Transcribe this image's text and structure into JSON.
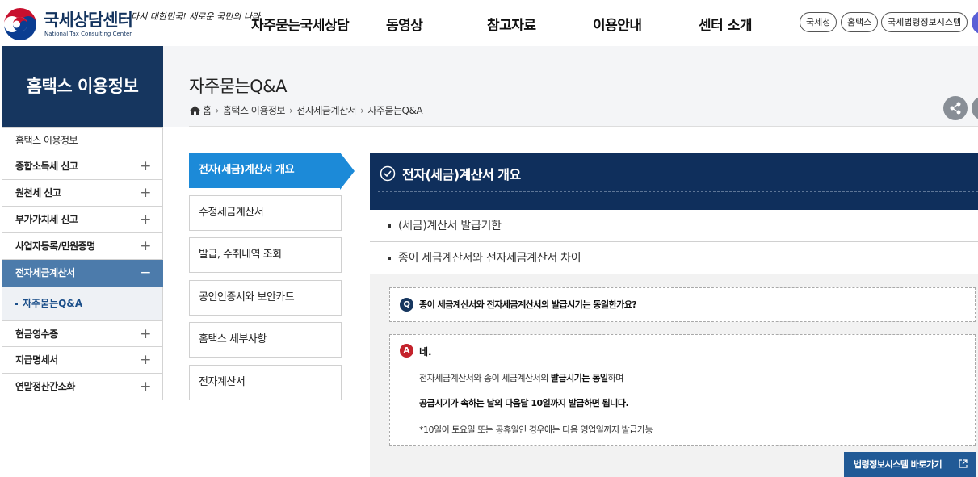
{
  "header": {
    "logo_title": "국세상담센터",
    "logo_subtitle": "National Tax Consulting Center",
    "logo_slogan": "다시 대한민국! 새로운 국민의 나라",
    "gnb": [
      "자주묻는국세상담",
      "동영상",
      "참고자료",
      "이용안내",
      "센터 소개"
    ],
    "util_links": [
      "국세청",
      "홈택스",
      "국세법령정보시스템"
    ]
  },
  "lnb": {
    "title": "홈택스 이용정보",
    "items": [
      {
        "label": "홈택스 이용정보",
        "toggle": ""
      },
      {
        "label": "종합소득세 신고",
        "toggle": "+"
      },
      {
        "label": "원천세 신고",
        "toggle": "+"
      },
      {
        "label": "부가가치세 신고",
        "toggle": "+"
      },
      {
        "label": "사업자등록/민원증명",
        "toggle": "+"
      },
      {
        "label": "전자세금계산서",
        "toggle": "−"
      },
      {
        "label": "현금영수증",
        "toggle": "+"
      },
      {
        "label": "지급명세서",
        "toggle": "+"
      },
      {
        "label": "연말정산간소화",
        "toggle": "+"
      }
    ],
    "sub_item": "자주묻는Q&A"
  },
  "content": {
    "page_title": "자주묻는Q&A",
    "breadcrumb": [
      "홈",
      "홈택스 이용정보",
      "전자세금계산서",
      "자주묻는Q&A"
    ],
    "tabs": [
      "전자(세금)계산서 개요",
      "수정세금계산서",
      "발급, 수취내역 조회",
      "공인인증서와 보안카드",
      "홈택스 세부사항",
      "전자계산서"
    ],
    "panel_title": "전자(세금)계산서 개요",
    "topics": [
      "(세금)계산서 발급기한",
      "종이 세금계산서와 전자세금계산서 차이"
    ],
    "question_badge": "Q",
    "question": "종이 세금계산서와 전자세금계산서의 발급시기는 동일한가요?",
    "answer_badge": "A",
    "answer_yes": "네.",
    "answer_line1_a": "전자세금계산서와 종이 세금계산서의 ",
    "answer_line1_b": "발급시기는 동일",
    "answer_line1_c": "하며",
    "answer_line2": "공급시기가 속하는 날의 다음달 10일까지 발급하면 됩니다.",
    "answer_line3": "*10일이 토요일 또는 공휴일인 경우에는 다음 영업일까지 발급가능",
    "law_button": "법령정보시스템 바로가기"
  }
}
